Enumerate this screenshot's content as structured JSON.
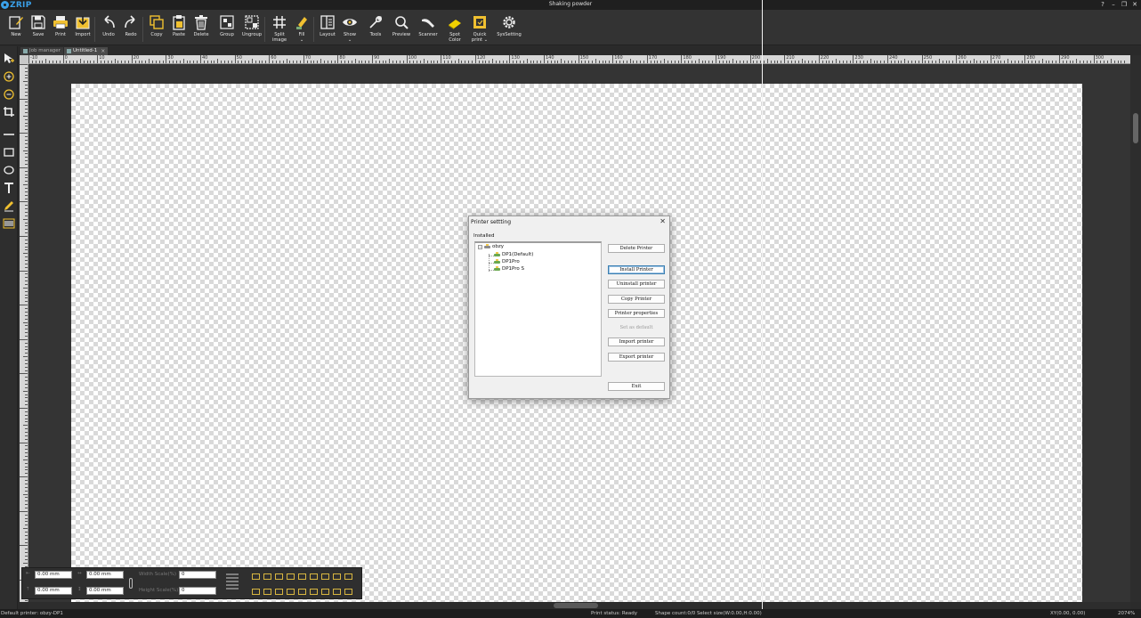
{
  "app": {
    "logo": "ZRIP",
    "title": "Shaking powder"
  },
  "window_controls": {
    "help": "?",
    "minimize": "–",
    "restore": "❐",
    "close": "✕"
  },
  "toolbar": [
    {
      "id": "new",
      "label": "New",
      "icon": "new-icon"
    },
    {
      "id": "save",
      "label": "Save",
      "icon": "save-icon"
    },
    {
      "id": "print",
      "label": "Print",
      "icon": "print-icon"
    },
    {
      "id": "import",
      "label": "Import",
      "icon": "import-icon"
    },
    {
      "id": "undo",
      "label": "Undo",
      "icon": "undo-icon"
    },
    {
      "id": "redo",
      "label": "Redo",
      "icon": "redo-icon"
    },
    {
      "id": "copy",
      "label": "Copy",
      "icon": "copy-icon"
    },
    {
      "id": "paste",
      "label": "Paste",
      "icon": "paste-icon"
    },
    {
      "id": "delete",
      "label": "Delete",
      "icon": "trash-icon"
    },
    {
      "id": "group",
      "label": "Group",
      "icon": "group-icon"
    },
    {
      "id": "ungroup",
      "label": "Ungroup",
      "icon": "ungroup-icon"
    },
    {
      "id": "split",
      "label": "Split\nimage",
      "icon": "grid-icon"
    },
    {
      "id": "fill",
      "label": "Fill",
      "icon": "fill-icon"
    },
    {
      "id": "layout",
      "label": "Layout",
      "icon": "layout-icon"
    },
    {
      "id": "show",
      "label": "Show",
      "icon": "eye-icon"
    },
    {
      "id": "tools",
      "label": "Tools",
      "icon": "wrench-icon"
    },
    {
      "id": "preview",
      "label": "Preview",
      "icon": "magnifier-icon"
    },
    {
      "id": "scanner",
      "label": "Scanner",
      "icon": "scanner-icon"
    },
    {
      "id": "spot",
      "label": "Spot\nColor",
      "icon": "spot-color-icon"
    },
    {
      "id": "quick",
      "label": "Quick\nprint",
      "icon": "quick-print-icon"
    },
    {
      "id": "sys",
      "label": "SysSetting",
      "icon": "gear-icon"
    }
  ],
  "tabs": [
    {
      "label": "Job manager"
    },
    {
      "label": "Untitled-1",
      "close": "×"
    }
  ],
  "ruler": {
    "h_labels": [
      "-10",
      "0",
      "10",
      "20",
      "30",
      "40",
      "50",
      "60",
      "70",
      "80",
      "90",
      "100",
      "110",
      "120",
      "130",
      "140",
      "150",
      "160",
      "170",
      "180",
      "190",
      "200",
      "210",
      "220",
      "230",
      "240",
      "250",
      "260",
      "270",
      "280",
      "290",
      "300"
    ]
  },
  "properties": {
    "x_value": "0.00 mm",
    "y_value": "0.00 mm",
    "w_value": "0.00 mm",
    "h_value": "0.00 mm",
    "width_scale_label": "Width Scale(%)",
    "width_scale_value": "0",
    "height_scale_label": "Height Scale(%)",
    "height_scale_value": "0"
  },
  "status": {
    "default_printer": "Default printer: obzy-DP1",
    "print_status": "Print status: Ready",
    "shape_count": "Shape count:0/0  Select size(W:0.00,H:0.00)",
    "xy": "XY(0.00, 0.00)",
    "zoom": "2074%"
  },
  "dialog": {
    "title": "Printer settting",
    "close": "✕",
    "group_label": "Installed",
    "tree": {
      "root": "obzy",
      "children": [
        "DP1(Default)",
        "DP1Pro",
        "DP1Pro S"
      ]
    },
    "buttons": {
      "delete": "Delete Printer",
      "install": "Install Printer",
      "uninstall": "Uninstall printer",
      "copy": "Copy Printer",
      "properties": "Printer properties",
      "set_default": "Set as default",
      "import": "Import printer",
      "export": "Export printer",
      "exit": "Exit"
    }
  }
}
